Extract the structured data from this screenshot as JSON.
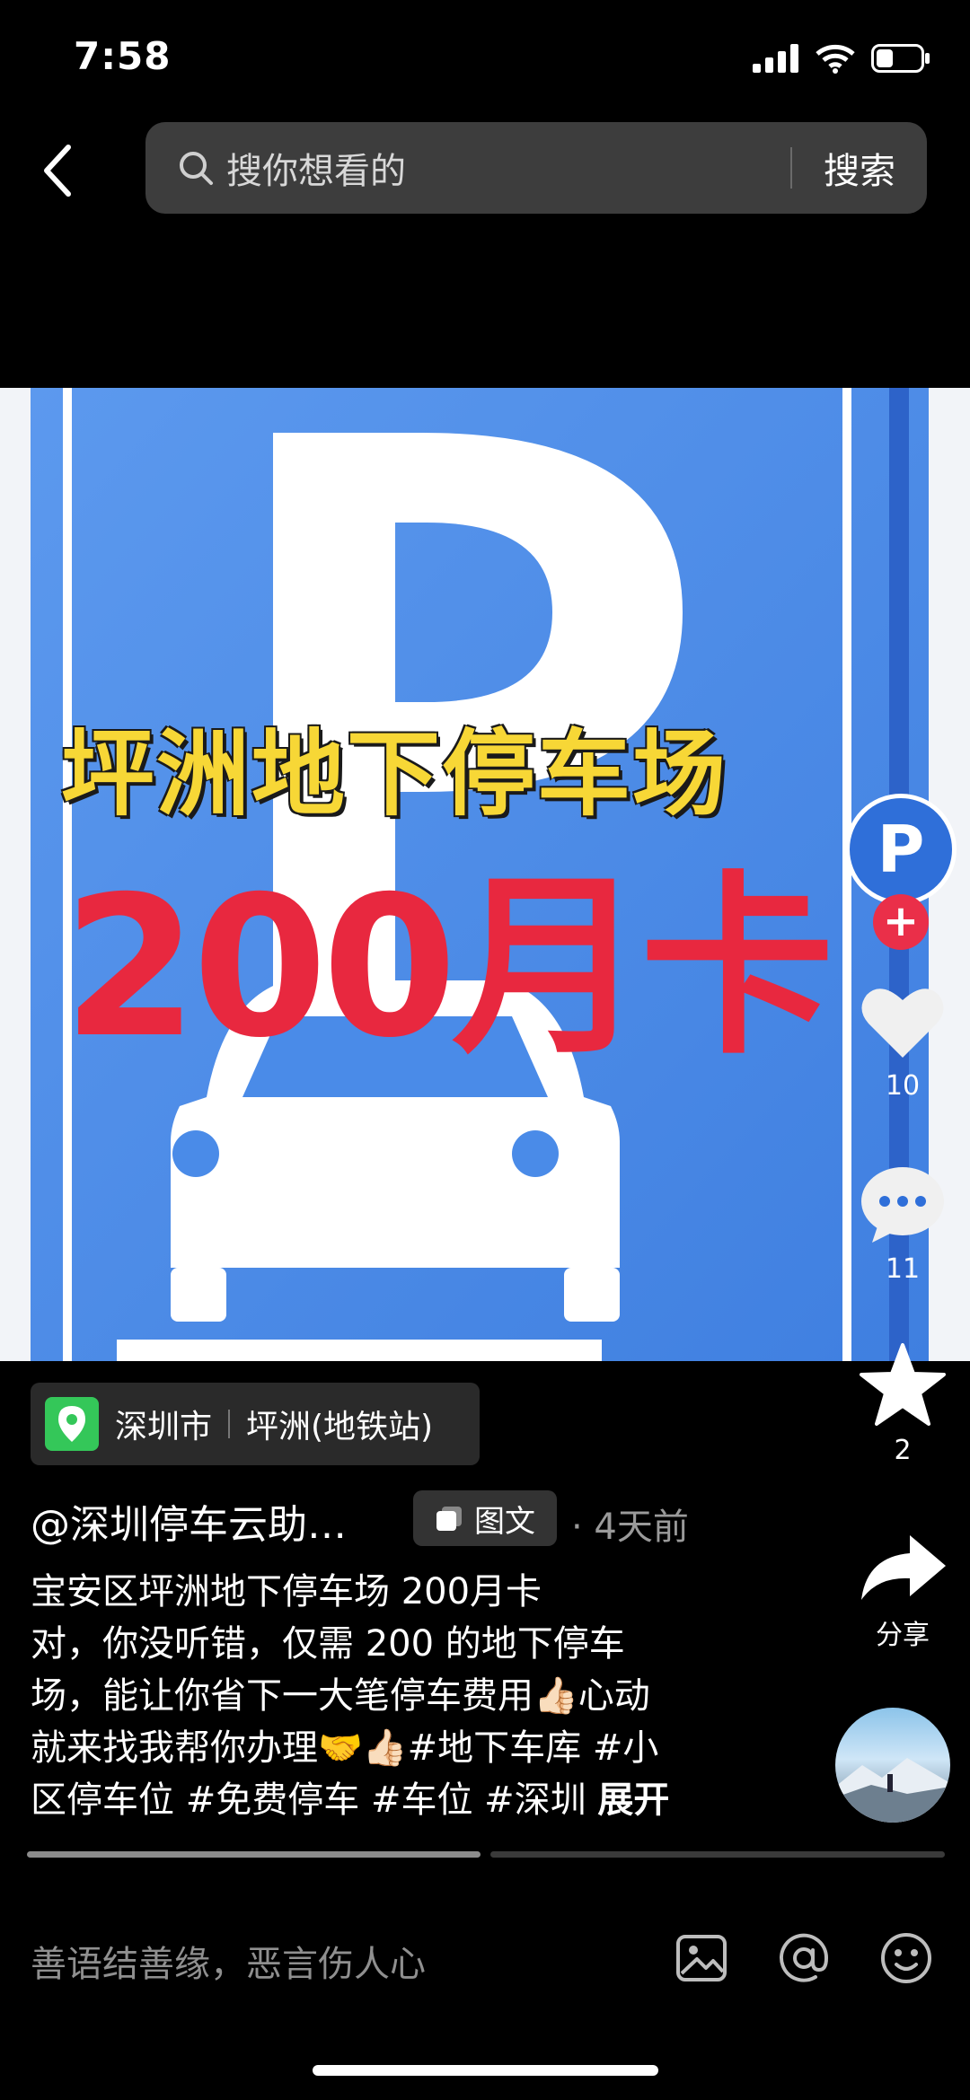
{
  "status": {
    "time": "7:58"
  },
  "header": {
    "search_placeholder": "搜你想看的",
    "search_button": "搜索"
  },
  "media": {
    "title_line": "坪洲地下停车场",
    "price_line": "200月卡",
    "sign_letter": "P"
  },
  "sidebar": {
    "avatar_letter": "P",
    "like_count": "10",
    "comment_count": "11",
    "favorite_count": "2",
    "share_label": "分享"
  },
  "location": {
    "city": "深圳市",
    "place": "坪洲(地铁站)"
  },
  "post": {
    "author": "@深圳停车云助…",
    "badge": "图文",
    "time": "· 4天前",
    "desc_lines": [
      "宝安区坪洲地下停车场 200月卡",
      "对，你没听错，仅需 200 的地下停车",
      "场，能让你省下一大笔停车费用👍🏻心动",
      "就来找我帮你办理🤝👍🏻#地下车库 #小",
      "区停车位 #免费停车 #车位 #深圳 "
    ],
    "expand": "展开"
  },
  "comment_bar": {
    "placeholder": "善语结善缘，恶言伤人心"
  },
  "colors": {
    "sign_blue": "#4a8be8",
    "headline_yellow": "#f7d736",
    "headline_red": "#e8283f"
  }
}
